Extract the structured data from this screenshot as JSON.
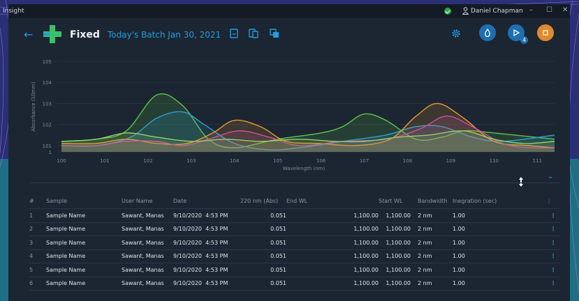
{
  "window": {
    "app_name": "Insight",
    "user_name": "Daniel Chapman",
    "minimize": "–",
    "maximize": "☐",
    "close": "✕"
  },
  "header": {
    "back": "←",
    "mode": "Fixed",
    "batch": "Today's Batch Jan 30, 2021",
    "play_badge": "4"
  },
  "colors": {
    "accent": "#1e9fe0",
    "play_button": "#1e6fb0",
    "stop_button": "#e0892e",
    "green": "#5cc74a",
    "cyan": "#2f9fd6",
    "orange": "#e99a2d",
    "magenta": "#cc4fa0",
    "lime": "#7fc84a"
  },
  "chart_data": {
    "type": "line",
    "ylabel": "Absorbance (10mm)",
    "xlabel": "Wavelength (nm)",
    "xlim": [
      100,
      111.4
    ],
    "ylim": [
      100.7,
      105
    ],
    "xticks": [
      "100",
      "101",
      "102",
      "103",
      "104",
      "105",
      "106",
      "107",
      "108",
      "109",
      "110",
      "111"
    ],
    "yticks": [
      "105",
      "104",
      "103",
      "102",
      "101",
      "1"
    ],
    "series": [
      {
        "color": "#5cc74a",
        "x": [
          100,
          100.8,
          101.5,
          102.2,
          102.8,
          103.4,
          104,
          105,
          106,
          106.5,
          107,
          107.5,
          108.2,
          108.8,
          109.3,
          110,
          111.4
        ],
        "y": [
          101.2,
          101.3,
          101.7,
          103.4,
          102.9,
          101.3,
          100.9,
          101.3,
          101.6,
          101.9,
          102.5,
          102.2,
          101.3,
          101.4,
          101.7,
          101.6,
          101.3
        ]
      },
      {
        "color": "#2f9fd6",
        "x": [
          100,
          100.8,
          101.6,
          102.2,
          102.8,
          103.3,
          104,
          104.8,
          105.5,
          106.5,
          107.5,
          108.2,
          108.8,
          109.5,
          110.2,
          111.4
        ],
        "y": [
          101.0,
          101.0,
          101.4,
          102.3,
          102.6,
          102.0,
          101.1,
          100.8,
          100.9,
          101.2,
          101.5,
          101.9,
          101.9,
          101.4,
          101.2,
          101.5
        ]
      },
      {
        "color": "#e99a2d",
        "x": [
          100,
          100.8,
          101.5,
          102.2,
          102.9,
          103.5,
          104,
          104.6,
          105.2,
          106,
          106.8,
          107.6,
          108.2,
          108.7,
          109.3,
          110,
          110.8,
          111.4
        ],
        "y": [
          101.1,
          101.1,
          101.3,
          101.1,
          101.1,
          101.6,
          102.2,
          101.9,
          101.2,
          101.1,
          101.0,
          101.3,
          102.4,
          103.0,
          102.3,
          101.2,
          101.0,
          100.9
        ]
      },
      {
        "color": "#cc4fa0",
        "x": [
          100,
          100.8,
          101.5,
          102.2,
          102.8,
          103.4,
          104.1,
          104.8,
          105.5,
          106.5,
          107.5,
          108.3,
          108.9,
          109.5,
          110.2,
          110.8,
          111.4
        ],
        "y": [
          101.0,
          101.0,
          101.2,
          101.2,
          101.0,
          101.3,
          101.7,
          101.4,
          101.0,
          101.2,
          101.3,
          101.8,
          102.4,
          101.9,
          101.1,
          100.9,
          100.9
        ]
      },
      {
        "color": "#8fd06a",
        "x": [
          100,
          100.8,
          101.5,
          102.2,
          103,
          103.8,
          104.6,
          105.5,
          106.3,
          107,
          107.8,
          108.5,
          109.3,
          110,
          110.7,
          111.4
        ],
        "y": [
          101.2,
          101.3,
          101.6,
          101.4,
          101.2,
          101.3,
          101.2,
          101.3,
          101.2,
          101.2,
          101.4,
          101.5,
          101.7,
          101.3,
          101.1,
          101.2
        ]
      }
    ]
  },
  "table": {
    "headers": {
      "idx": "#",
      "sample": "Sample",
      "user": "User Name",
      "date": "Date",
      "abs": "220 nm (Abs)",
      "end_wl": "End WL",
      "start_wl": "Start WL",
      "bandwidth": "Bandwidth",
      "integration": "Inegration (sec)"
    },
    "rows": [
      {
        "idx": "1",
        "sample": "Sample Name",
        "user": "Sawant, Manas",
        "date": "9/10/2020",
        "time": "4:53 PM",
        "abs": "0.051",
        "end_wl": "1,100.00",
        "start_wl": "1,100.00",
        "bandwidth": "2 nm",
        "integration": "1.00"
      },
      {
        "idx": "2",
        "sample": "Sample Name",
        "user": "Sawant, Manas",
        "date": "9/10/2020",
        "time": "4:53 PM",
        "abs": "0.051",
        "end_wl": "1,100.00",
        "start_wl": "1,100.00",
        "bandwidth": "2 nm",
        "integration": "1.00"
      },
      {
        "idx": "3",
        "sample": "Sample Name",
        "user": "Sawant, Manas",
        "date": "9/10/2020",
        "time": "4:53 PM",
        "abs": "0.051",
        "end_wl": "1,100.00",
        "start_wl": "1,100.00",
        "bandwidth": "2 nm",
        "integration": "1.00"
      },
      {
        "idx": "4",
        "sample": "Sample Name",
        "user": "Sawant, Manas",
        "date": "9/10/2020",
        "time": "4:53 PM",
        "abs": "0.051",
        "end_wl": "1,100.00",
        "start_wl": "1,100.00",
        "bandwidth": "2 nm",
        "integration": "1.00"
      },
      {
        "idx": "5",
        "sample": "Sample Name",
        "user": "Sawant, Manas",
        "date": "9/10/2020",
        "time": "4:53 PM",
        "abs": "0.051",
        "end_wl": "1,100.00",
        "start_wl": "1,100.00",
        "bandwidth": "2 nm",
        "integration": "1.00"
      },
      {
        "idx": "6",
        "sample": "Sample Name",
        "user": "Sawant, Manas",
        "date": "9/10/2020",
        "time": "4:53 PM",
        "abs": "0.051",
        "end_wl": "1,100.00",
        "start_wl": "1,100.00",
        "bandwidth": "2 nm",
        "integration": "1.00"
      }
    ]
  }
}
